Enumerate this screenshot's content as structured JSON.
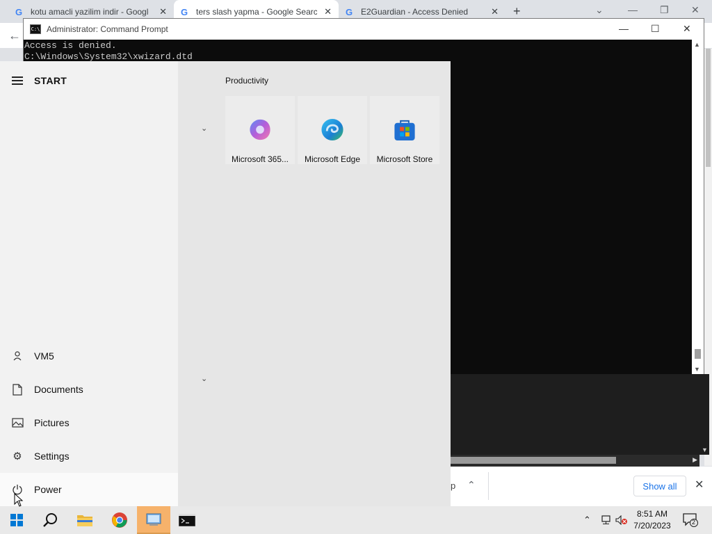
{
  "browser": {
    "tabs": [
      {
        "title": "kotu amacli yazilim indir - Google",
        "active": false
      },
      {
        "title": "ters slash yapma - Google Search",
        "active": true
      },
      {
        "title": "E2Guardian - Access Denied",
        "active": false
      }
    ],
    "new_tab_label": "+"
  },
  "cmd": {
    "title": "Administrator:  Command Prompt",
    "lines": [
      "Access is denied.",
      "C:\\Windows\\System32\\xwizard.dtd"
    ]
  },
  "download_bar": {
    "partial_text": "p",
    "show_all_label": "Show all",
    "close_label": "✕"
  },
  "start_menu": {
    "header": "START",
    "items": [
      {
        "label": "VM5",
        "icon": "user-icon"
      },
      {
        "label": "Documents",
        "icon": "document-icon"
      },
      {
        "label": "Pictures",
        "icon": "pictures-icon"
      },
      {
        "label": "Settings",
        "icon": "gear-icon"
      },
      {
        "label": "Power",
        "icon": "power-icon"
      }
    ],
    "group": {
      "title": "Productivity",
      "tiles": [
        {
          "label": "Microsoft 365...",
          "icon": "microsoft-365-icon"
        },
        {
          "label": "Microsoft Edge",
          "icon": "edge-icon"
        },
        {
          "label": "Microsoft Store",
          "icon": "store-icon"
        }
      ]
    }
  },
  "taskbar": {
    "apps": [
      "start-icon",
      "search-icon",
      "file-explorer-icon",
      "chrome-icon",
      "tablet-app-icon",
      "command-prompt-icon"
    ],
    "clock": {
      "time": "8:51 AM",
      "date": "7/20/2023"
    },
    "notification_count": "2"
  }
}
